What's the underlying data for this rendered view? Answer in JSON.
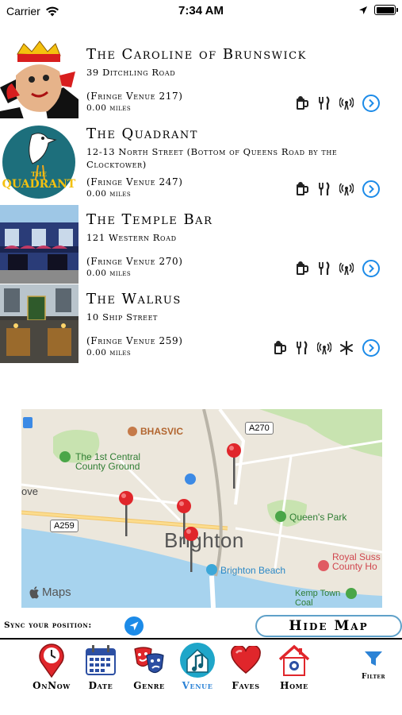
{
  "status_bar": {
    "carrier": "Carrier",
    "time": "7:34 AM"
  },
  "venues": [
    {
      "name": "The Caroline of Brunswick",
      "address": "39 Ditchling Road",
      "fringe": "(Fringe Venue 217)",
      "distance": "0.00 miles",
      "amenities": [
        "beer-icon",
        "food-icon",
        "wifi-icon"
      ]
    },
    {
      "name": "The Quadrant",
      "address": "12-13 North Street (Bottom of Queens Road by the Clocktower)",
      "fringe": "(Fringe Venue 247)",
      "distance": "0.00 miles",
      "amenities": [
        "beer-icon",
        "food-icon",
        "wifi-icon"
      ],
      "logo_text": "THE QUADRANT"
    },
    {
      "name": "The Temple Bar",
      "address": "121 Western Road",
      "fringe": "(Fringe Venue 270)",
      "distance": "0.00 miles",
      "amenities": [
        "beer-icon",
        "food-icon",
        "wifi-icon"
      ]
    },
    {
      "name": "The Walrus",
      "address": "10 Ship Street",
      "fringe": "(Fringe Venue 259)",
      "distance": "0.00 miles",
      "amenities": [
        "beer-icon",
        "food-icon",
        "wifi-icon",
        "snowflake-icon"
      ]
    }
  ],
  "map": {
    "labels": {
      "bhasvic": "BHASVIC",
      "cricket": "The 1st Central County Ground",
      "hove": "ove",
      "queens_park": "Queen's Park",
      "brighton": "Brighton",
      "brighton_beach": "Brighton Beach",
      "royal_sussex": "Royal Suss County Ho",
      "kemp_town": "Kemp Town Coal Enclosures",
      "road_a270": "A270",
      "road_a259": "A259",
      "maps_brand": "Maps"
    }
  },
  "sync": {
    "label": "Sync your position:",
    "hide_map": "Hide Map"
  },
  "tabs": [
    {
      "label": "OnNow"
    },
    {
      "label": "Date"
    },
    {
      "label": "Genre"
    },
    {
      "label": "Venue",
      "active": true
    },
    {
      "label": "Faves"
    },
    {
      "label": "Home"
    }
  ],
  "filter": {
    "label": "Filter"
  },
  "colors": {
    "accent": "#2c83d6",
    "pin": "#e0262b",
    "sea": "#a7d3ee",
    "park": "#c8e3b0"
  }
}
